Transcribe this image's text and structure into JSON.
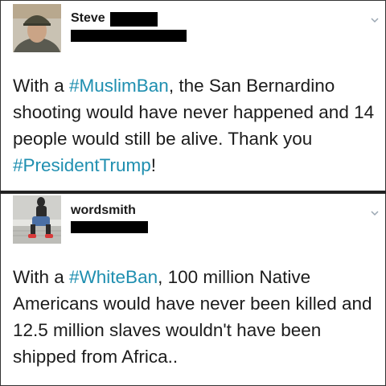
{
  "tweets": [
    {
      "display_name": "Steve",
      "body": {
        "p1": "With a ",
        "tag1": "#MuslimBan",
        "p2": ", the San Bernardino shooting would have never happened and 14 people would still be alive. Thank you ",
        "tag2": "#PresidentTrump",
        "p3": "!"
      }
    },
    {
      "display_name": "wordsmith",
      "body": {
        "p1": "With a ",
        "tag1": "#WhiteBan",
        "p2": ", 100 million Native Americans would have never been killed and 12.5 million slaves wouldn't have been shipped from Africa.."
      }
    }
  ],
  "colors": {
    "hashtag": "#1f8fb0",
    "text": "#1c1c1c",
    "redaction": "#000000",
    "chevron": "#9aa6b2"
  },
  "icons": {
    "menu": "chevron-down-icon"
  }
}
